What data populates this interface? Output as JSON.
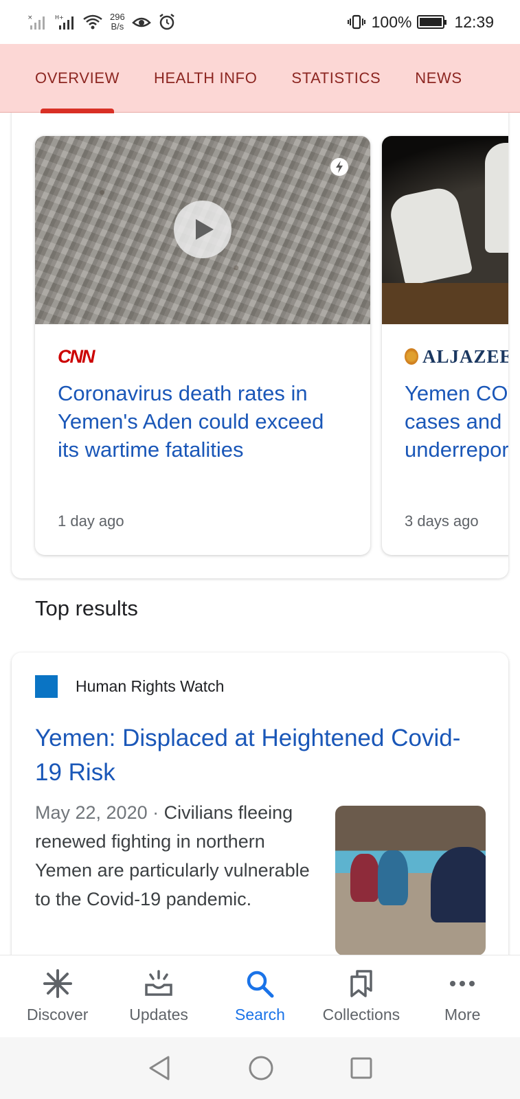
{
  "status_bar": {
    "network_speed_value": "296",
    "network_speed_unit": "B/s",
    "battery_percent": "100%",
    "time": "12:39"
  },
  "tabs": [
    {
      "label": "OVERVIEW",
      "active": true
    },
    {
      "label": "HEALTH INFO",
      "active": false
    },
    {
      "label": "STATISTICS",
      "active": false
    },
    {
      "label": "NEWS",
      "active": false
    }
  ],
  "top_stories": [
    {
      "source": "CNN",
      "headline_lines": [
        "Coronavirus death rates in",
        "Yemen's Aden could exceed",
        "its wartime fatalities"
      ],
      "time": "1 day ago",
      "has_video": true,
      "amp": true
    },
    {
      "source": "ALJAZEE",
      "headline_lines": [
        "Yemen COV",
        "cases and c",
        "underreport"
      ],
      "time": "3 days ago"
    }
  ],
  "top_results": {
    "heading": "Top results",
    "items": [
      {
        "site": "Human Rights Watch",
        "title": "Yemen: Displaced at Heightened Covid-19 Risk",
        "date": "May 22, 2020",
        "separator": " · ",
        "snippet": "Civilians fleeing renewed fighting in northern Yemen are particularly vulnerable to the Covid-19 pandemic."
      }
    ]
  },
  "bottom_nav": [
    {
      "label": "Discover",
      "icon": "asterisk-icon",
      "active": false
    },
    {
      "label": "Updates",
      "icon": "updates-tray-icon",
      "active": false
    },
    {
      "label": "Search",
      "icon": "search-icon",
      "active": true
    },
    {
      "label": "Collections",
      "icon": "bookmarks-icon",
      "active": false
    },
    {
      "label": "More",
      "icon": "more-dots-icon",
      "active": false
    }
  ],
  "colors": {
    "tab_bar_bg": "#fcd7d5",
    "tab_text": "#8c2621",
    "tab_indicator": "#d93025",
    "link_blue": "#1a57b8",
    "active_nav": "#1a73e8",
    "hrw_blue": "#0a74c4"
  }
}
